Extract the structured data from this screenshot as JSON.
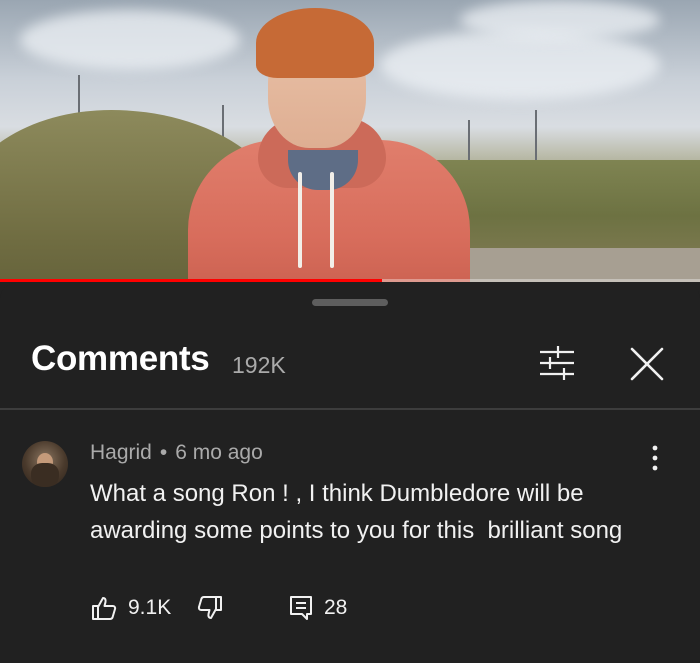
{
  "video": {
    "progress_fraction": 0.545,
    "colors": {
      "progress": "#ff0000",
      "track": "rgba(255,255,255,0.35)"
    }
  },
  "comments_panel": {
    "title": "Comments",
    "count": "192K",
    "filter_icon": "sliders-icon",
    "close_icon": "close-icon"
  },
  "comment": {
    "author": "Hagrid",
    "separator": "•",
    "time": "6 mo ago",
    "text": "What a song Ron ! , I think Dumbledore will be awarding some points to you for this  brilliant song",
    "likes": "9.1K",
    "replies": "28",
    "icons": [
      "thumbs-up-icon",
      "thumbs-down-icon",
      "reply-icon",
      "more-vertical-icon"
    ]
  },
  "colors": {
    "background": "#212121",
    "text_primary": "#f1f1f1",
    "text_secondary": "#aaaaaa",
    "divider": "#3d3d3d"
  }
}
